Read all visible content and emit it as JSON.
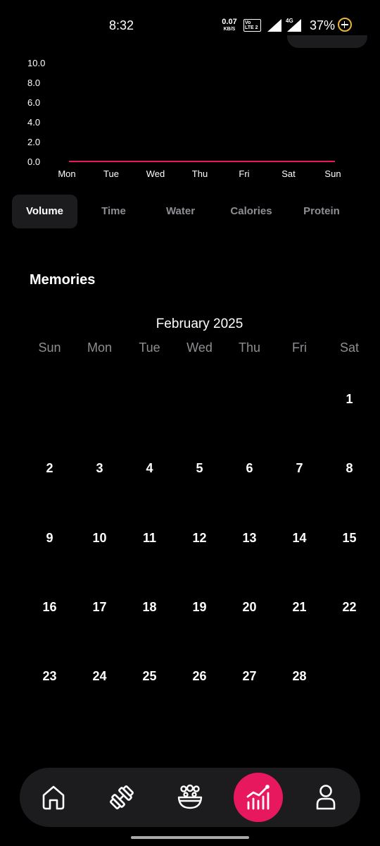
{
  "status_bar": {
    "time": "8:32",
    "net_speed_value": "0.07",
    "net_speed_unit": "KB/S",
    "volte_label": "Vo LTE 2",
    "network_type": "4G",
    "battery_percent": "37%",
    "battery_color": "#e8b43a"
  },
  "chart_data": {
    "type": "line",
    "categories": [
      "Mon",
      "Tue",
      "Wed",
      "Thu",
      "Fri",
      "Sat",
      "Sun"
    ],
    "series": [
      {
        "values": [
          0,
          0,
          0,
          0,
          0,
          0,
          0
        ],
        "color": "#e7185d"
      }
    ],
    "yticks": [
      "0.0",
      "2.0",
      "4.0",
      "6.0",
      "8.0",
      "10.0"
    ],
    "ylim": [
      0,
      10
    ],
    "grid": false,
    "title": "",
    "xlabel": "",
    "ylabel": ""
  },
  "metric_tabs": [
    {
      "label": "Volume",
      "active": true
    },
    {
      "label": "Time",
      "active": false
    },
    {
      "label": "Water",
      "active": false
    },
    {
      "label": "Calories",
      "active": false
    },
    {
      "label": "Protein",
      "active": false
    }
  ],
  "memories": {
    "title": "Memories",
    "calendar": {
      "month_title": "February 2025",
      "weekdays": [
        "Sun",
        "Mon",
        "Tue",
        "Wed",
        "Thu",
        "Fri",
        "Sat"
      ],
      "leading_blank_days": 6,
      "days": [
        "1",
        "2",
        "3",
        "4",
        "5",
        "6",
        "7",
        "8",
        "9",
        "10",
        "11",
        "12",
        "13",
        "14",
        "15",
        "16",
        "17",
        "18",
        "19",
        "20",
        "21",
        "22",
        "23",
        "24",
        "25",
        "26",
        "27",
        "28"
      ]
    }
  },
  "bottom_nav": {
    "items": [
      {
        "icon": "home-icon",
        "active": false
      },
      {
        "icon": "dumbbell-icon",
        "active": false
      },
      {
        "icon": "food-bowl-icon",
        "active": false
      },
      {
        "icon": "stats-chart-icon",
        "active": true
      },
      {
        "icon": "profile-icon",
        "active": false
      }
    ],
    "active_color": "#e7185d"
  }
}
